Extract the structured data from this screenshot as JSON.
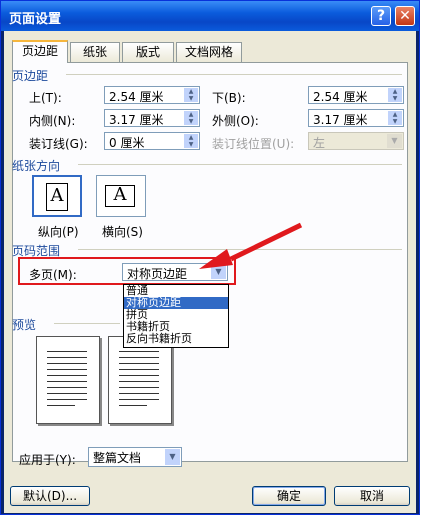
{
  "title": "页面设置",
  "tabs": [
    "页边距",
    "纸张",
    "版式",
    "文档网格"
  ],
  "margins": {
    "group": "页边距",
    "top_label": "上(T):",
    "top_value": "2.54 厘米",
    "bottom_label": "下(B):",
    "bottom_value": "2.54 厘米",
    "inside_label": "内侧(N):",
    "inside_value": "3.17 厘米",
    "outside_label": "外侧(O):",
    "outside_value": "3.17 厘米",
    "gutter_label": "装订线(G):",
    "gutter_value": "0 厘米",
    "gutter_pos_label": "装订线位置(U):",
    "gutter_pos_value": "左"
  },
  "orientation": {
    "group": "纸张方向",
    "portrait_label": "纵向(P)",
    "landscape_label": "横向(S)",
    "glyph": "A"
  },
  "pages": {
    "group": "页码范围",
    "multi_label": "多页(M):",
    "multi_value": "对称页边距",
    "options": [
      "普通",
      "对称页边距",
      "拼页",
      "书籍折页",
      "反向书籍折页"
    ],
    "highlighted_index": 1
  },
  "preview": {
    "group": "预览"
  },
  "apply": {
    "label": "应用于(Y):",
    "value": "整篇文档"
  },
  "buttons": {
    "default": "默认(D)...",
    "ok": "确定",
    "cancel": "取消"
  },
  "colors": {
    "annotation": "#e0191d",
    "selection": "#316ac5"
  }
}
